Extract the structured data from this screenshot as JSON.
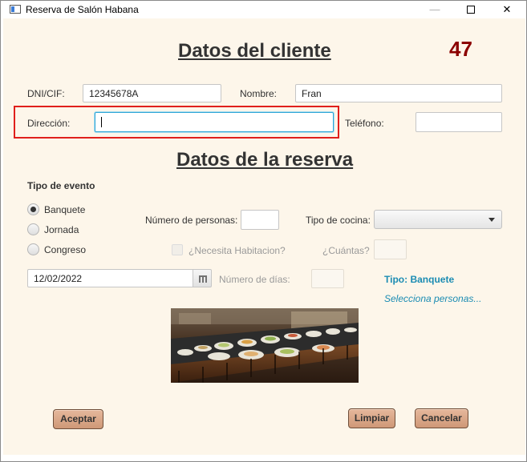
{
  "window": {
    "title": "Reserva de Salón Habana"
  },
  "cliente": {
    "heading": "Datos del cliente",
    "counter": "47",
    "dni_label": "DNI/CIF:",
    "dni_value": "12345678A",
    "nombre_label": "Nombre:",
    "nombre_value": "Fran",
    "direccion_label": "Dirección:",
    "direccion_value": "",
    "telefono_label": "Teléfono:",
    "telefono_value": ""
  },
  "reserva": {
    "heading": "Datos de la reserva",
    "tipo_evento_label": "Tipo de evento",
    "eventos": [
      {
        "label": "Banquete",
        "checked": true
      },
      {
        "label": "Jornada",
        "checked": false
      },
      {
        "label": "Congreso",
        "checked": false
      }
    ],
    "personas_label": "Número de personas:",
    "personas_value": "",
    "cocina_label": "Tipo de cocina:",
    "cocina_value": "",
    "habitacion_label": "¿Necesita Habitacion?",
    "cuantas_label": "¿Cuántas?",
    "cuantas_value": "",
    "fecha_value": "12/02/2022",
    "dias_label": "Número de días:",
    "dias_value": "",
    "info_tipo": "Tipo: Banquete",
    "info_personas": "Selecciona personas..."
  },
  "buttons": {
    "aceptar": "Aceptar",
    "limpiar": "Limpiar",
    "cancelar": "Cancelar"
  },
  "colors": {
    "background": "#fdf6ea",
    "counter": "#8b0000",
    "info": "#1b8cb3",
    "button": "#d9a585",
    "highlight": "#e0201c"
  }
}
